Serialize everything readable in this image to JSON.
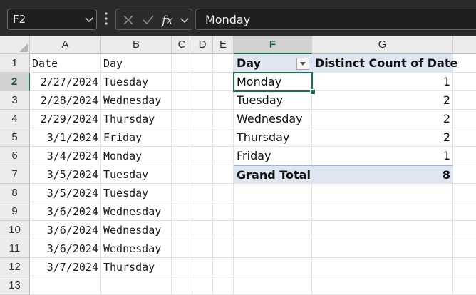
{
  "formula_bar": {
    "name_box": "F2",
    "cancel_icon": "close-icon",
    "enter_icon": "check-icon",
    "function_icon": "fx",
    "formula": "Monday"
  },
  "columns": [
    "A",
    "B",
    "C",
    "D",
    "E",
    "F",
    "G"
  ],
  "rows": [
    "1",
    "2",
    "3",
    "4",
    "5",
    "6",
    "7",
    "8",
    "9",
    "10",
    "11",
    "12",
    "13"
  ],
  "selected": {
    "column": "F",
    "row": "2"
  },
  "source_table": {
    "header": {
      "date": "Date",
      "day": "Day"
    },
    "rows": [
      {
        "date": "2/27/2024",
        "day": "Tuesday"
      },
      {
        "date": "2/28/2024",
        "day": "Wednesday"
      },
      {
        "date": "2/29/2024",
        "day": "Thursday"
      },
      {
        "date": "3/1/2024",
        "day": "Friday"
      },
      {
        "date": "3/4/2024",
        "day": "Monday"
      },
      {
        "date": "3/5/2024",
        "day": "Tuesday"
      },
      {
        "date": "3/5/2024",
        "day": "Tuesday"
      },
      {
        "date": "3/6/2024",
        "day": "Wednesday"
      },
      {
        "date": "3/6/2024",
        "day": "Wednesday"
      },
      {
        "date": "3/6/2024",
        "day": "Wednesday"
      },
      {
        "date": "3/7/2024",
        "day": "Thursday"
      }
    ]
  },
  "pivot": {
    "header_label": "Day",
    "header_value": "Distinct Count of Date",
    "rows": [
      {
        "label": "Monday",
        "value": "1"
      },
      {
        "label": "Tuesday",
        "value": "2"
      },
      {
        "label": "Wednesday",
        "value": "2"
      },
      {
        "label": "Thursday",
        "value": "2"
      },
      {
        "label": "Friday",
        "value": "1"
      }
    ],
    "total_label": "Grand Total",
    "total_value": "8"
  },
  "colors": {
    "accent": "#217346",
    "pivot_header": "#dde6f1",
    "toolbar": "#2b2b2b"
  }
}
